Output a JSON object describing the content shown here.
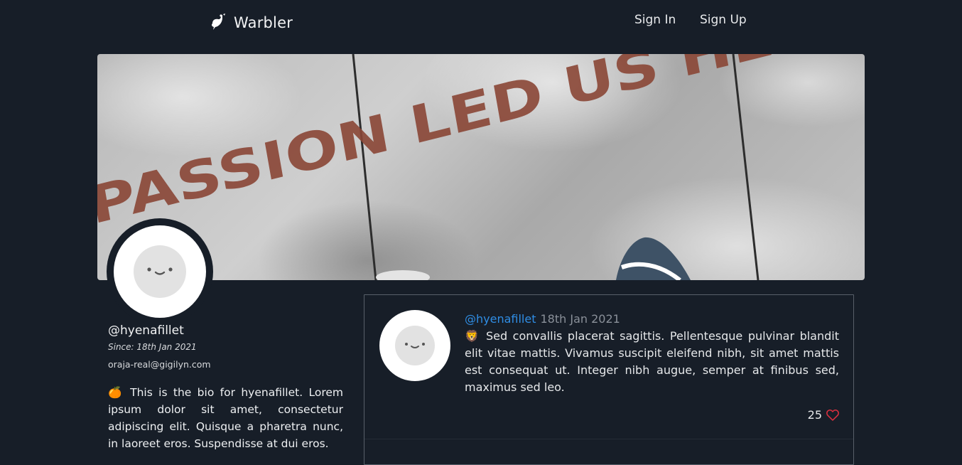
{
  "nav": {
    "brand": "Warbler",
    "sign_in": "Sign In",
    "sign_up": "Sign Up"
  },
  "hero": {
    "image_text": "PASSION LED US HERE"
  },
  "profile": {
    "username": "@hyenafillet",
    "since": "Since: 18th Jan 2021",
    "email": "oraja-real@gigilyn.com",
    "bio": "🍊 This is the bio for hyenafillet. Lorem ipsum dolor sit amet, consectetur adipiscing elit. Quisque a pharetra nunc, in laoreet eros. Suspendisse at dui eros."
  },
  "messages": [
    {
      "username": "@hyenafillet",
      "date": "18th Jan 2021",
      "text": "🦁 Sed convallis placerat sagittis. Pellentesque pulvinar blandit elit vitae mattis. Vivamus suscipit eleifend nibh, sit amet mattis est consequat ut. Integer nibh augue, semper at finibus sed, maximus sed leo.",
      "likes": "25"
    }
  ],
  "colors": {
    "background": "#171e28",
    "link": "#2f8de4",
    "heart": "#e0303f",
    "muted": "#8a9099"
  },
  "icons": {
    "brand": "bird-icon",
    "like": "heart-outline-icon",
    "avatar": "default-face-avatar"
  }
}
